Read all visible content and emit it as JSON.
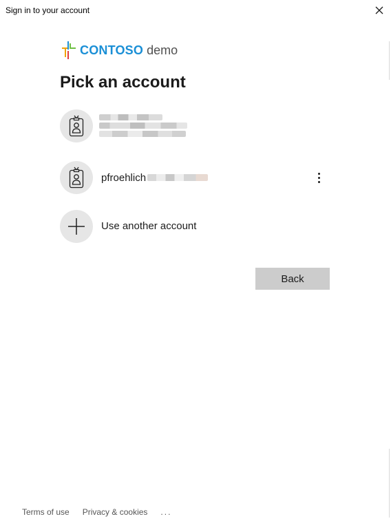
{
  "window": {
    "title": "Sign in to your account"
  },
  "logo": {
    "brand": "CONTOSO",
    "suffix": "demo",
    "colors": [
      "#f0a30a",
      "#1a8fd6",
      "#e03d3d",
      "#6fbf44"
    ]
  },
  "page": {
    "title": "Pick an account"
  },
  "accounts": [
    {
      "display": "",
      "icon": "id-badge-icon"
    },
    {
      "display": "pfroehlich",
      "icon": "id-badge-icon"
    }
  ],
  "other_account": {
    "label": "Use another account",
    "icon": "plus-icon"
  },
  "back_button": {
    "label": "Back"
  },
  "footer": {
    "terms": "Terms of use",
    "privacy": "Privacy & cookies",
    "more": "..."
  }
}
